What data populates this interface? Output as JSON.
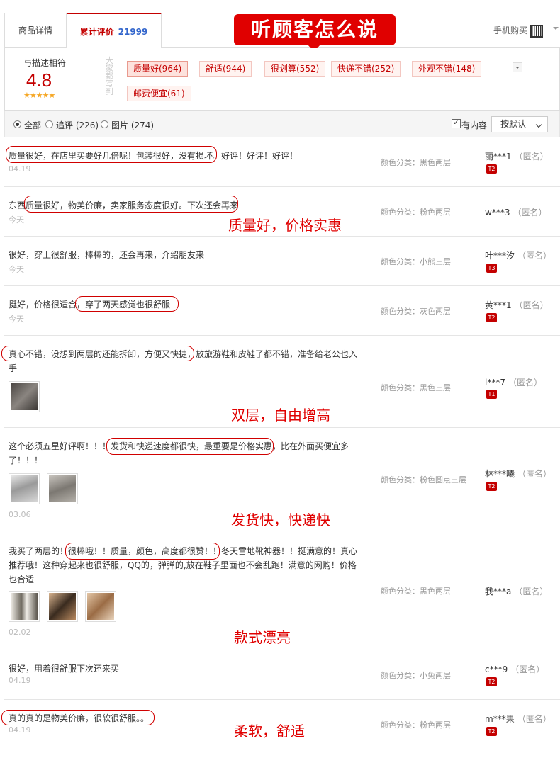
{
  "tabs": {
    "detail": "商品详情",
    "reviews_label": "累计评价",
    "reviews_count": "21999",
    "mobile_buy": "手机购买"
  },
  "banner": "听顾客怎么说",
  "summary": {
    "score_label": "与描述相符",
    "score": "4.8",
    "stars": "★★★★★",
    "side_label": "大家都写到",
    "tags": [
      "质量好(964)",
      "舒适(944)",
      "很划算(552)",
      "快递不错(252)",
      "外观不错(148)",
      "邮费便宜(61)"
    ]
  },
  "filter": {
    "all": "全部",
    "append": "追评 (226)",
    "pictures": "图片 (274)",
    "has_content": "有内容",
    "sort": "按默认"
  },
  "reviews": [
    {
      "text": "质量很好，在店里买要好几倍呢！包装很好，没有损坏。好评！好评！好评！",
      "date": "04.19",
      "sku": "颜色分类：黑色两层",
      "user": "丽***1",
      "anon": "（匿名）",
      "level": "T2"
    },
    {
      "text": "东西质量很好，物美价廉，卖家服务态度很好。下次还会再来",
      "date": "今天",
      "sku": "颜色分类：粉色两层",
      "user": "w***3",
      "anon": "（匿名）",
      "level": ""
    },
    {
      "text": "很好，穿上很舒服，棒棒的，还会再来，介绍朋友来",
      "date": "今天",
      "sku": "颜色分类：小熊三层",
      "user": "叶***汐",
      "anon": "（匿名）",
      "level": "T3"
    },
    {
      "text": "挺好，价格很适合，穿了两天感觉也很舒服",
      "date": "今天",
      "sku": "颜色分类：灰色两层",
      "user": "黄***1",
      "anon": "（匿名）",
      "level": "T2"
    },
    {
      "text": "真心不错，没想到两层的还能拆卸，方便又快捷，放旅游鞋和皮鞋了都不错，准备给老公也入手",
      "date": "",
      "sku": "颜色分类：黑色三层",
      "user": "l***7",
      "anon": "（匿名）",
      "level": "T1"
    },
    {
      "text": "这个必须五星好评啊！！！发货和快递速度都很快，最重要是价格实惠，比在外面买便宜多了！！！",
      "date": "03.06",
      "sku": "颜色分类：粉色圆点三层",
      "user": "林***曦",
      "anon": "（匿名）",
      "level": "T2"
    },
    {
      "text": "我买了两层的！很棒哦！！质量，颜色，高度都很赞！！冬天雪地靴神器！！挺满意的！真心推荐哦！这种穿起来也很舒服，QQ的，弹弹的,放在鞋子里面也不会乱跑！满意的网购！价格也合适",
      "date": "02.02",
      "sku": "颜色分类：黑色两层",
      "user": "我***a",
      "anon": "（匿名）",
      "level": ""
    },
    {
      "text": "很好，用着很舒服下次还来买",
      "date": "04.19",
      "sku": "颜色分类：小兔两层",
      "user": "c***9",
      "anon": "（匿名）",
      "level": "T2"
    },
    {
      "text": "真的真的是物美价廉，很软很舒服。。",
      "date": "04.19",
      "sku": "颜色分类：粉色两层",
      "user": "m***果",
      "anon": "（匿名）",
      "level": "T2"
    }
  ],
  "annotations": [
    "质量好，价格实惠",
    "双层，自由增高",
    "发货快，快递快",
    "款式漂亮",
    "柔软，舒适"
  ],
  "colors": {
    "accent": "#c40000",
    "banner": "#e00000",
    "link": "#3366cc",
    "star": "#f5a623"
  }
}
